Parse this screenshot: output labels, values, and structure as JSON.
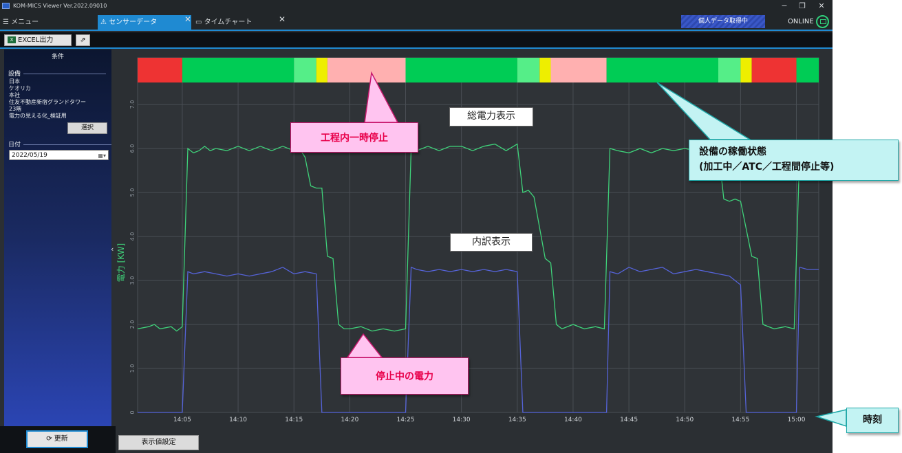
{
  "titlebar": {
    "app_title": "KOM-MICS Viewer  Ver.2022.09010",
    "min": "−",
    "max": "❐",
    "close": "✕"
  },
  "tabs": {
    "menu_label": "☰ メニュー",
    "sensor_label": "⚠ センサーデータ",
    "time_label": "▭ タイムチャート",
    "close": "✕",
    "personal_status": "個人データ取得中",
    "online_label": "ONLINE"
  },
  "toolbar": {
    "excel_label": "EXCEL出力",
    "excel_icon": "X",
    "export_icon": "⇗"
  },
  "left_panel": {
    "header": "条件",
    "equipment_title": "設備",
    "equipment_lines": [
      "日本",
      "ケオリカ",
      "本社",
      "住友不動産新宿グランドタワー",
      "23階",
      "電力の見える化_検証用"
    ],
    "select_label": "選択",
    "date_title": "日付",
    "date_value": "2022/05/19",
    "date_icon": "▦▾",
    "collapse_icon": "‹"
  },
  "bottom": {
    "refresh_label": "⟳ 更新",
    "display_settings_label": "表示値設定"
  },
  "annotations": {
    "total_power": "総電力表示",
    "breakdown": "内訳表示",
    "pause": "工程内一時停止",
    "stopped_power": "停止中の電力",
    "status_line1": "設備の稼働状態",
    "status_line2": "(加工中／ATC／工程間停止等)",
    "time": "時刻"
  },
  "colors": {
    "processing": "#00cc55",
    "atc": "#55ee88",
    "yellow": "#eeee00",
    "pause": "#ffb0b0",
    "stop": "#ee3333",
    "total_line": "#3fd27a",
    "breakdown_line": "#5563d8",
    "accent": "#1f8ad2"
  },
  "chart_data": {
    "type": "line",
    "xlabel": "",
    "ylabel": "電力 [KW]",
    "x_unit": "time",
    "xlim": [
      "14:01",
      "15:02"
    ],
    "ylim": [
      0,
      7.5
    ],
    "yticks": [
      "0",
      "1.0",
      "2.0",
      "3.0",
      "4.0",
      "5.0",
      "6.0",
      "7.0"
    ],
    "xticks": [
      "14:05",
      "14:10",
      "14:15",
      "14:20",
      "14:25",
      "14:30",
      "14:35",
      "14:40",
      "14:45",
      "14:50",
      "14:55",
      "15:00"
    ],
    "grid": true,
    "series": [
      {
        "name": "総電力",
        "values": [
          [
            "14:01",
            1.9
          ],
          [
            "14:02",
            1.95
          ],
          [
            "14:02.5",
            2.0
          ],
          [
            "14:03",
            1.9
          ],
          [
            "14:04",
            1.95
          ],
          [
            "14:04.5",
            1.85
          ],
          [
            "14:05",
            1.95
          ],
          [
            "14:05.5",
            6.0
          ],
          [
            "14:06",
            5.9
          ],
          [
            "14:06.5",
            5.95
          ],
          [
            "14:07",
            6.05
          ],
          [
            "14:07.5",
            5.95
          ],
          [
            "14:08",
            6.0
          ],
          [
            "14:09",
            5.95
          ],
          [
            "14:10",
            6.05
          ],
          [
            "14:11",
            5.95
          ],
          [
            "14:12",
            6.05
          ],
          [
            "14:13",
            5.95
          ],
          [
            "14:14",
            6.05
          ],
          [
            "14:15",
            5.95
          ],
          [
            "14:15.5",
            6.0
          ],
          [
            "14:16",
            5.8
          ],
          [
            "14:16.5",
            5.15
          ],
          [
            "14:17",
            5.1
          ],
          [
            "14:17.5",
            5.1
          ],
          [
            "14:18",
            3.55
          ],
          [
            "14:18.5",
            3.5
          ],
          [
            "14:19",
            2.0
          ],
          [
            "14:19.5",
            1.9
          ],
          [
            "14:20",
            1.9
          ],
          [
            "14:21",
            1.95
          ],
          [
            "14:22",
            1.85
          ],
          [
            "14:23",
            1.9
          ],
          [
            "14:24",
            1.85
          ],
          [
            "14:25",
            1.9
          ],
          [
            "14:25.5",
            6.0
          ],
          [
            "14:26",
            5.95
          ],
          [
            "14:27",
            6.05
          ],
          [
            "14:28",
            5.95
          ],
          [
            "14:29",
            6.05
          ],
          [
            "14:30",
            6.05
          ],
          [
            "14:31",
            5.95
          ],
          [
            "14:32",
            6.05
          ],
          [
            "14:33",
            6.1
          ],
          [
            "14:34",
            5.95
          ],
          [
            "14:35",
            6.1
          ],
          [
            "14:35.5",
            5.0
          ],
          [
            "14:36",
            5.05
          ],
          [
            "14:36.5",
            4.9
          ],
          [
            "14:37.5",
            3.5
          ],
          [
            "14:38",
            3.4
          ],
          [
            "14:38.5",
            2.0
          ],
          [
            "14:39",
            1.9
          ],
          [
            "14:40",
            2.0
          ],
          [
            "14:41",
            1.9
          ],
          [
            "14:42",
            1.95
          ],
          [
            "14:42.8",
            1.9
          ],
          [
            "14:43.3",
            6.0
          ],
          [
            "14:44",
            5.95
          ],
          [
            "14:45",
            5.9
          ],
          [
            "14:46",
            6.0
          ],
          [
            "14:47",
            5.9
          ],
          [
            "14:48",
            6.0
          ],
          [
            "14:49",
            5.95
          ],
          [
            "14:50",
            6.0
          ],
          [
            "14:51",
            5.95
          ],
          [
            "14:52",
            5.95
          ],
          [
            "14:53",
            6.0
          ],
          [
            "14:53.5",
            4.85
          ],
          [
            "14:54",
            4.8
          ],
          [
            "14:54.5",
            4.85
          ],
          [
            "14:55",
            4.8
          ],
          [
            "14:56",
            3.55
          ],
          [
            "14:56.5",
            3.5
          ],
          [
            "14:57",
            2.0
          ],
          [
            "14:58",
            1.9
          ],
          [
            "14:59",
            1.95
          ],
          [
            "14:59.8",
            1.9
          ],
          [
            "15:00.3",
            6.0
          ],
          [
            "15:01",
            5.95
          ],
          [
            "15:02",
            6.0
          ]
        ]
      },
      {
        "name": "内訳",
        "values": [
          [
            "14:01",
            0.0
          ],
          [
            "14:05",
            0.0
          ],
          [
            "14:05.5",
            3.2
          ],
          [
            "14:06",
            3.15
          ],
          [
            "14:07",
            3.2
          ],
          [
            "14:08",
            3.15
          ],
          [
            "14:09",
            3.1
          ],
          [
            "14:10",
            3.15
          ],
          [
            "14:11",
            3.1
          ],
          [
            "14:12",
            3.15
          ],
          [
            "14:13",
            3.2
          ],
          [
            "14:14",
            3.3
          ],
          [
            "14:15",
            3.15
          ],
          [
            "14:16",
            3.2
          ],
          [
            "14:17",
            3.15
          ],
          [
            "14:17.5",
            0.0
          ],
          [
            "14:25",
            0.0
          ],
          [
            "14:25.5",
            3.3
          ],
          [
            "14:26",
            3.25
          ],
          [
            "14:27",
            3.2
          ],
          [
            "14:28",
            3.25
          ],
          [
            "14:29",
            3.2
          ],
          [
            "14:30",
            3.25
          ],
          [
            "14:31",
            3.2
          ],
          [
            "14:32",
            3.25
          ],
          [
            "14:33",
            3.2
          ],
          [
            "14:34",
            3.25
          ],
          [
            "14:35",
            3.2
          ],
          [
            "14:35.5",
            0.0
          ],
          [
            "14:43",
            0.0
          ],
          [
            "14:43.3",
            3.2
          ],
          [
            "14:44",
            3.15
          ],
          [
            "14:45",
            3.3
          ],
          [
            "14:46",
            3.2
          ],
          [
            "14:47",
            3.25
          ],
          [
            "14:48",
            3.3
          ],
          [
            "14:49",
            3.15
          ],
          [
            "14:50",
            3.2
          ],
          [
            "14:51",
            3.25
          ],
          [
            "14:52",
            3.2
          ],
          [
            "14:53",
            3.15
          ],
          [
            "14:54",
            3.1
          ],
          [
            "14:55",
            2.9
          ],
          [
            "14:55.5",
            0.0
          ],
          [
            "15:00",
            0.0
          ],
          [
            "15:00.3",
            3.3
          ],
          [
            "15:01",
            3.25
          ],
          [
            "15:02",
            3.25
          ]
        ]
      }
    ],
    "status_bar": [
      {
        "start": "14:01",
        "end": "14:05",
        "state": "stop"
      },
      {
        "start": "14:05",
        "end": "14:15",
        "state": "processing"
      },
      {
        "start": "14:15",
        "end": "14:17",
        "state": "atc"
      },
      {
        "start": "14:17",
        "end": "14:18",
        "state": "yellow"
      },
      {
        "start": "14:18",
        "end": "14:25",
        "state": "pause"
      },
      {
        "start": "14:25",
        "end": "14:35",
        "state": "processing"
      },
      {
        "start": "14:35",
        "end": "14:37",
        "state": "atc"
      },
      {
        "start": "14:37",
        "end": "14:38",
        "state": "yellow"
      },
      {
        "start": "14:38",
        "end": "14:43",
        "state": "pause"
      },
      {
        "start": "14:43",
        "end": "14:53",
        "state": "processing"
      },
      {
        "start": "14:53",
        "end": "14:55",
        "state": "atc"
      },
      {
        "start": "14:55",
        "end": "14:56",
        "state": "yellow"
      },
      {
        "start": "14:56",
        "end": "15:00",
        "state": "stop"
      },
      {
        "start": "15:00",
        "end": "15:02",
        "state": "processing"
      }
    ]
  }
}
